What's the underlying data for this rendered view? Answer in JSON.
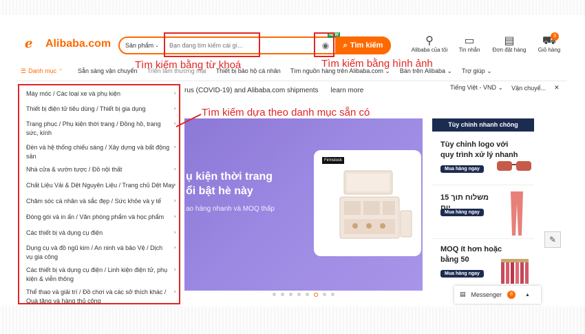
{
  "header": {
    "logo_text": "Alibaba.com",
    "search_category": "Sản phẩm",
    "search_placeholder": "Bạn đang tìm kiếm cái gì...",
    "new_badge": "NEW",
    "search_button": "Tìm kiếm",
    "icons": [
      {
        "name": "user-icon",
        "label": "Alibaba của tôi"
      },
      {
        "name": "message-icon",
        "label": "Tin nhắn"
      },
      {
        "name": "orders-icon",
        "label": "Đơn đặt hàng"
      },
      {
        "name": "cart-icon",
        "label": "Giỏ hàng"
      }
    ],
    "cart_count": "3"
  },
  "annotations": {
    "keyword_search": "Tìm kiếm bằng từ khoá",
    "image_search": "Tìm kiếm bằng hình ảnh",
    "category_search": "Tìm kiếm dựa theo danh mục sẵn có"
  },
  "nav": {
    "categories": "Danh mục",
    "items": [
      "Sẵn sàng vận chuyển",
      "Triển lãm thương mại",
      "Thiết bị bảo hộ cá nhân",
      "Tìm nguồn hàng trên Alibaba.com",
      "Bán trên Alibaba",
      "Trợ giúp"
    ]
  },
  "info_bar": {
    "text": "rus (COVID-19) and Alibaba.com shipments",
    "learn_more": "learn more",
    "language": "Tiếng Việt - VND",
    "shipping": "Vận chuyể..."
  },
  "sidebar": {
    "items": [
      "Máy móc / Các loại xe và phụ kiện",
      "Thiết bị điện tử tiêu dùng / Thiết bị gia dụng",
      "Trang phục / Phụ kiện thời trang / Đồng hồ, trang sức, kính",
      "Đèn và hệ thống chiếu sáng / Xây dựng và bất động sản",
      "Nhà cửa & vườn tược / Đồ nội thất",
      "Chất Liệu Vải & Dệt Nguyên Liệu / Trang chủ Dệt May",
      "Chăm sóc cá nhân và sắc đẹp / Sức khỏe và y tế",
      "Đóng gói và in ấn / Văn phòng phẩm và học phẩm",
      "Các thiết bị và dụng cụ điện",
      "Dụng cụ và đồ ngũ kim / An ninh và bảo Vệ / Dịch vụ gia công",
      "Các thiết bị và dụng cụ điện / Linh kiện điện tử, phụ kiện & viễn thông",
      "Thể thao và giải trí / Đồ chơi và các sở thích khác / Quà tặng và hàng thủ công"
    ]
  },
  "hero": {
    "title_line1": "ụ kiện thời trang",
    "title_line2": "ổi bật hè này",
    "subtitle": "ao hàng nhanh và MOQ thấp",
    "brand": "Firmstock"
  },
  "right_panel": {
    "header": "Tùy chỉnh nhanh chóng",
    "blocks": [
      {
        "title": "Tùy chỉnh logo với quy trình xử lý nhanh",
        "button": "Mua hàng ngay"
      },
      {
        "title": "משלוח תוך 15 יום",
        "button": "Mua hàng ngay"
      },
      {
        "title": "MOQ ít hơn hoặc bằng 50",
        "button": "Mua hàng ngay"
      }
    ]
  },
  "messenger": {
    "label": "Messenger",
    "count": "8"
  },
  "colors": {
    "brand": "#ff6a00",
    "annotation": "#e02424",
    "navy": "#1c2c51",
    "hero": "#9d8ae3"
  }
}
